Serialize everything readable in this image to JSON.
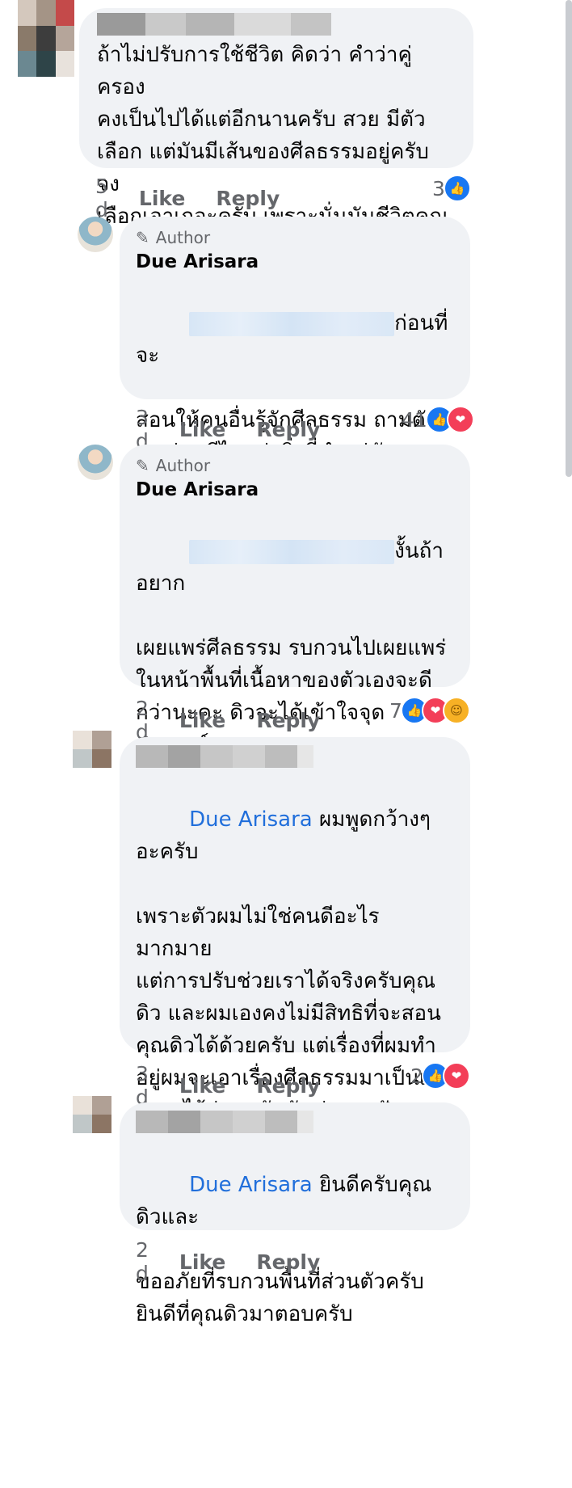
{
  "comments": [
    {
      "text": "ถ้าไม่ปรับการใช้ชีวิต คิดว่า คำว่าคู่ครอง\nคงเป็นไปได้แต่อีกนานครับ สวย มีตัว\nเลือก แต่มันมีเส้นของศีลธรรมอยู่ครับ จง\nเลือกเอาเถอะครับ เพราะนั่นมันชีวิตคุณ",
      "time": "5 d",
      "like": "Like",
      "reply": "Reply",
      "react_count": "3"
    },
    {
      "author_badge": "Author",
      "name": "Due Arisara",
      "text_line1_end": "ก่อนที่จะ",
      "text_rest": "สอนให้คนอื่นรู้จักศีลธรรม ถามตัว\nเองก่อนดีไหมว่าสิ่งที่ทำอยู่มันถูก\nแล้วจริงๆเหรอ",
      "time": "3 d",
      "like": "Like",
      "reply": "Reply",
      "react_count": "41"
    },
    {
      "author_badge": "Author",
      "name": "Due Arisara",
      "text_line1_end": "งั้นถ้าอยาก",
      "text_rest": "เผยแพร่ศีลธรรม รบกวนไปเผยแพร่\nในหน้าพื้นที่เนื้อหาของตัวเองจะดี\nกว่านะคะ ดิวจะได้เข้าใจจุดประสงค์\nว่า ต้องการสอนศีลธรรมไม่ได้มีนัย\nยะอื่นๆผสม ขอบคุณคะ",
      "time": "2 d",
      "like": "Like",
      "reply": "Reply",
      "react_count": "7"
    },
    {
      "mention": "Due Arisara",
      "text_line1_end": " ผมพูดกว้างๆอะครับ",
      "text_rest": "เพราะตัวผมไม่ใช่คนดีอะไรมากมาย\nแต่การปรับช่วยเราได้จริงครับคุณ\nดิว และผมเองคงไม่มีสิทธิที่จะสอน\nคุณดิวได้ด้วยครับ แต่เรื่องที่ผมทำ\nอยู่ผมจะเอาเรื่องศีลธรรมมาเป็นเส้น\nกลางไว้ก่อนครับมันช่วยลดปัญหา\nลงได้หลายเรื่อง ยินดีมากครับที่คุณ\nดิว มาตอบด้วยตัวเองครับ",
      "time": "3 d",
      "like": "Like",
      "reply": "Reply",
      "react_count": "2"
    },
    {
      "mention": "Due Arisara",
      "text_line1_end": " ยินดีครับคุณดิวและ",
      "text_rest": "ขออภัยที่รบกวนพื้นที่ส่วนตัวครับ\nยินดีที่คุณดิวมาตอบครับ",
      "time": "2 d",
      "like": "Like",
      "reply": "Reply"
    }
  ],
  "icons": {
    "author": "pencil-icon",
    "like_reaction": "like-reaction-icon",
    "love_reaction": "love-reaction-icon",
    "care_reaction": "care-reaction-icon"
  },
  "colors": {
    "bubble": "#f0f2f5",
    "mention": "#216fdb",
    "meta": "#65676b",
    "like": "#1877f2",
    "love": "#f33e58"
  }
}
